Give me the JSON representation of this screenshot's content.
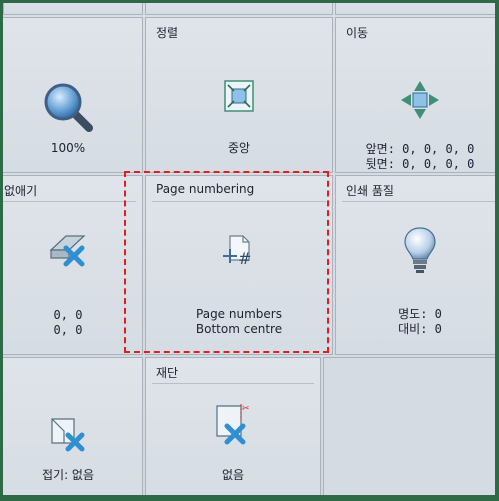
{
  "panels": {
    "alignment": {
      "title": "정렬",
      "value": "중앙"
    },
    "move": {
      "title": "이동",
      "line1": "앞면: 0, 0, 0, 0",
      "line2": "뒷면: 0, 0, 0, 0"
    },
    "zoom": {
      "value": "100%"
    },
    "remove": {
      "title": "없애기",
      "line1": "0, 0",
      "line2": "0, 0"
    },
    "page_numbering": {
      "title": "Page numbering",
      "line1": "Page numbers",
      "line2": "Bottom centre"
    },
    "print_quality": {
      "title": "인쇄 품질",
      "line1": "명도: 0",
      "line2": "대비: 0"
    },
    "crop": {
      "title": "재단",
      "value": "없음"
    },
    "fold": {
      "value": "접기: 없음"
    }
  },
  "colors": {
    "highlight": "#e01e1e",
    "frame": "#2f6a46",
    "panel_bg": "#d9dee4"
  }
}
